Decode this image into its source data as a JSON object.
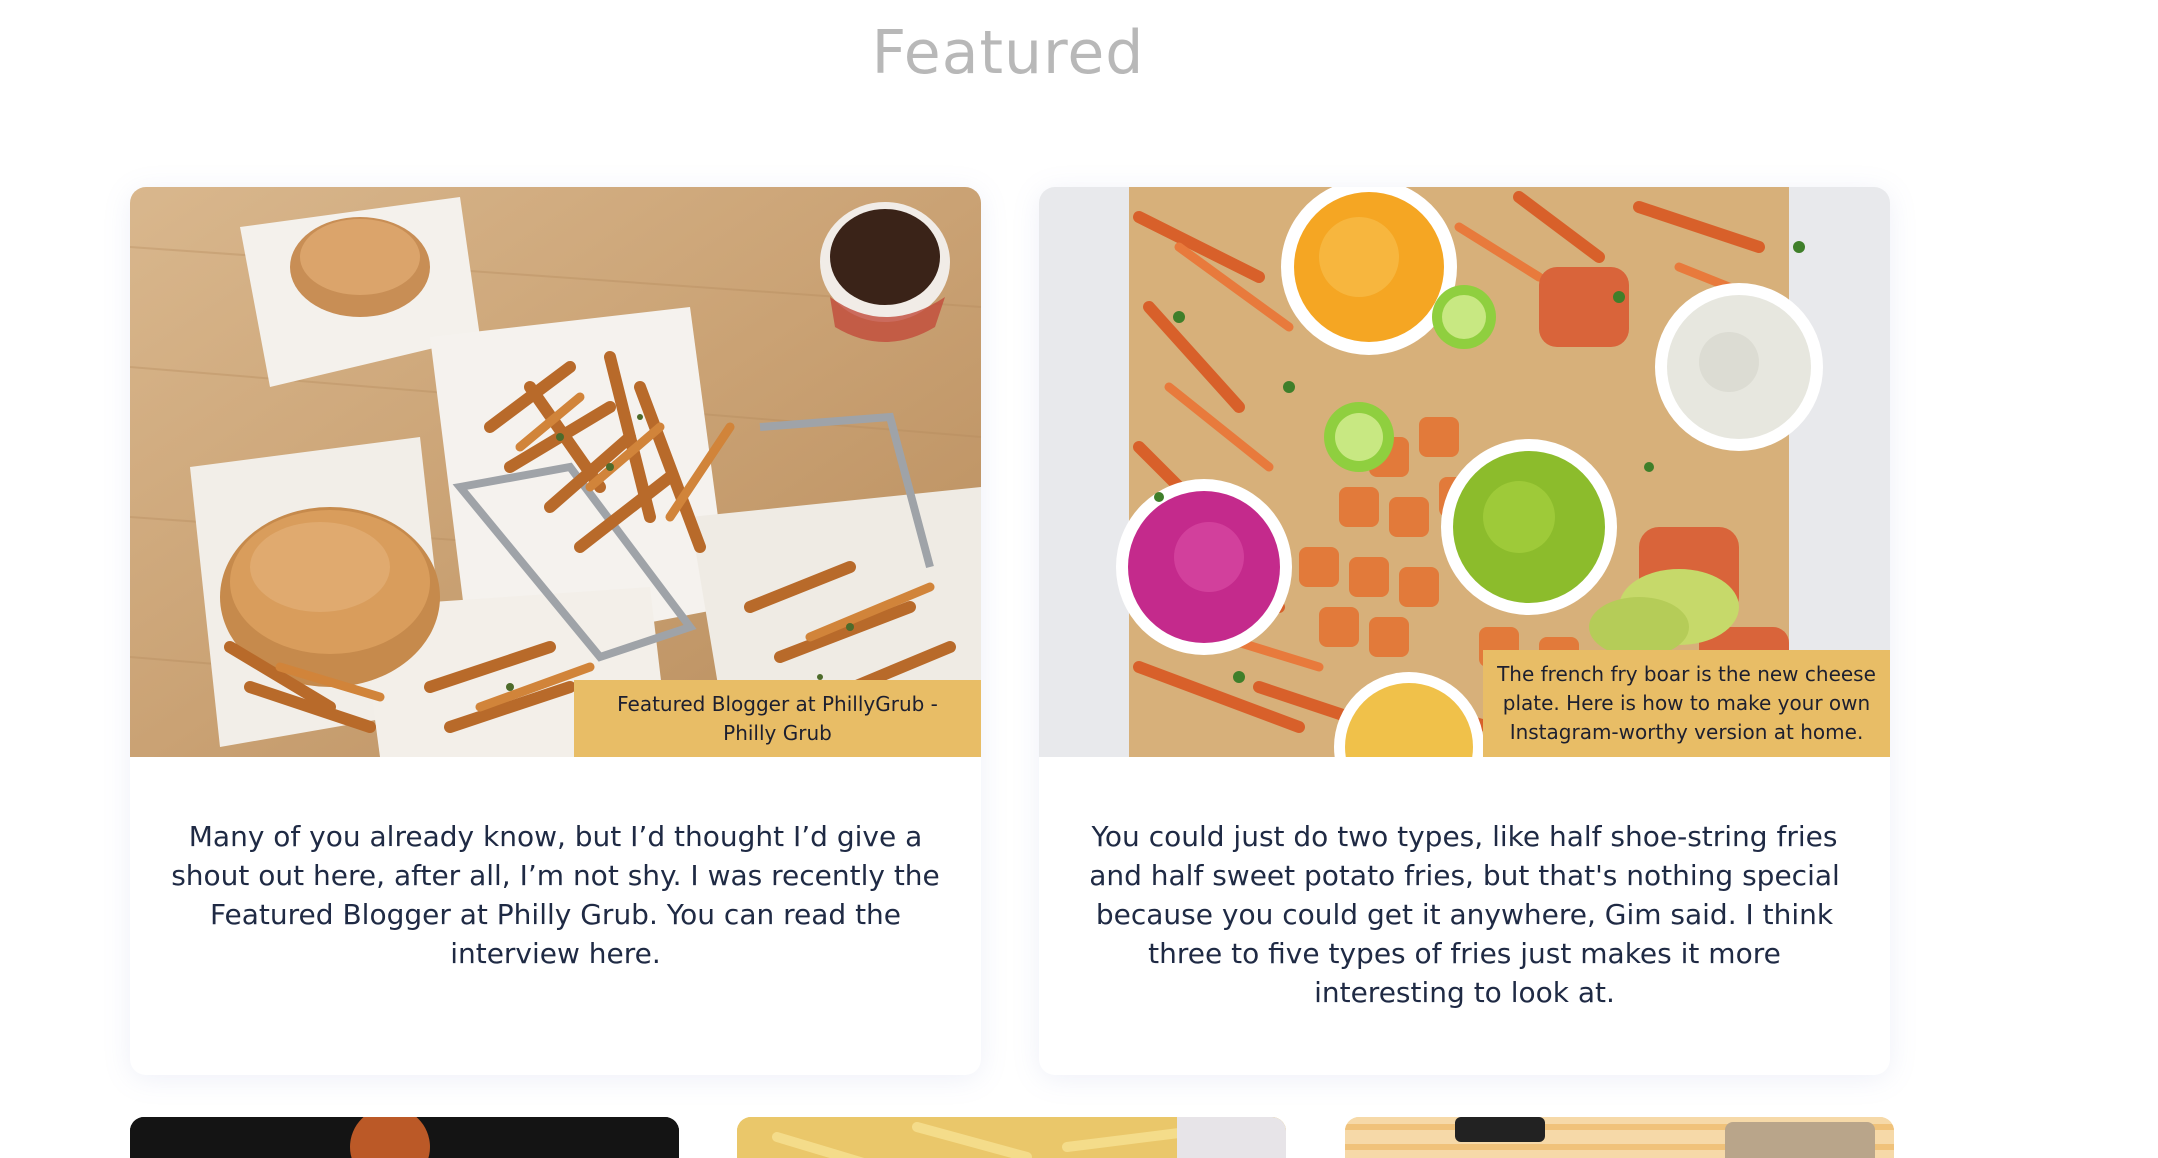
{
  "section": {
    "title": "Featured"
  },
  "cards": [
    {
      "caption": "Featured Blogger at PhillyGrub - Philly Grub",
      "text": "Many of you already know, but I’d thought I’d give a shout out here, after all, I’m not shy. I was recently the Featured Blogger at Philly Grub. You can read the interview here."
    },
    {
      "caption": "The french fry boar is the new cheese plate. Here is how to make your own Instagram-worthy version at home.",
      "text": "You could just do two types, like half shoe-string fries and half sweet potato fries, but that's nothing special because you could get it anywhere, Gim said. I think three to five types of fries just makes it more interesting to look at."
    }
  ],
  "colors": {
    "caption_bg": "#e8bd66",
    "title": "#b8b8b8",
    "body_text": "#1f2a44"
  }
}
